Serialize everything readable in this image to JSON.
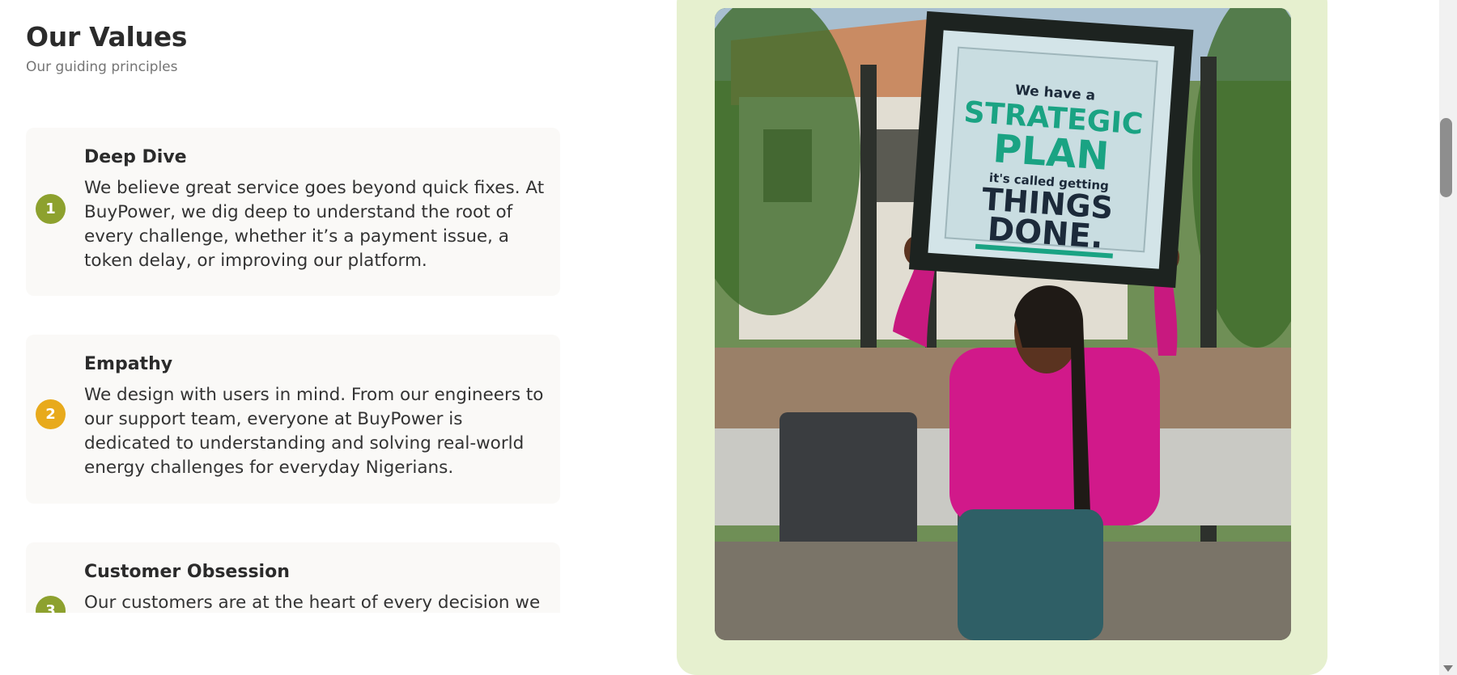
{
  "header": {
    "title": "Our Values",
    "subtitle": "Our guiding principles"
  },
  "values": [
    {
      "number": "1",
      "title": "Deep Dive",
      "description": "We believe great service goes beyond quick fixes. At BuyPower, we dig deep to understand the root of every challenge, whether it’s a payment issue, a token delay, or improving our platform.",
      "badge_color": "#8da12e"
    },
    {
      "number": "2",
      "title": "Empathy",
      "description": "We design with users in mind. From our engineers to our support team, everyone at BuyPower is dedicated to understanding and solving real-world energy challenges for everyday Nigerians.",
      "badge_color": "#e8aa1c"
    },
    {
      "number": "3",
      "title": "Customer Obsession",
      "description": "Our customers are at the heart of every decision we make.",
      "badge_color": "#8da12e"
    }
  ],
  "photo": {
    "sign_text": {
      "line1": "We have a",
      "line2": "STRATEGIC",
      "line3": "PLAN",
      "line4": "it's called getting",
      "line5": "THINGS",
      "line6": "DONE."
    }
  },
  "colors": {
    "panel_background": "#e6f0cf",
    "card_background": "#faf9f7",
    "accent_green": "#8da12e",
    "accent_yellow": "#e8aa1c"
  }
}
